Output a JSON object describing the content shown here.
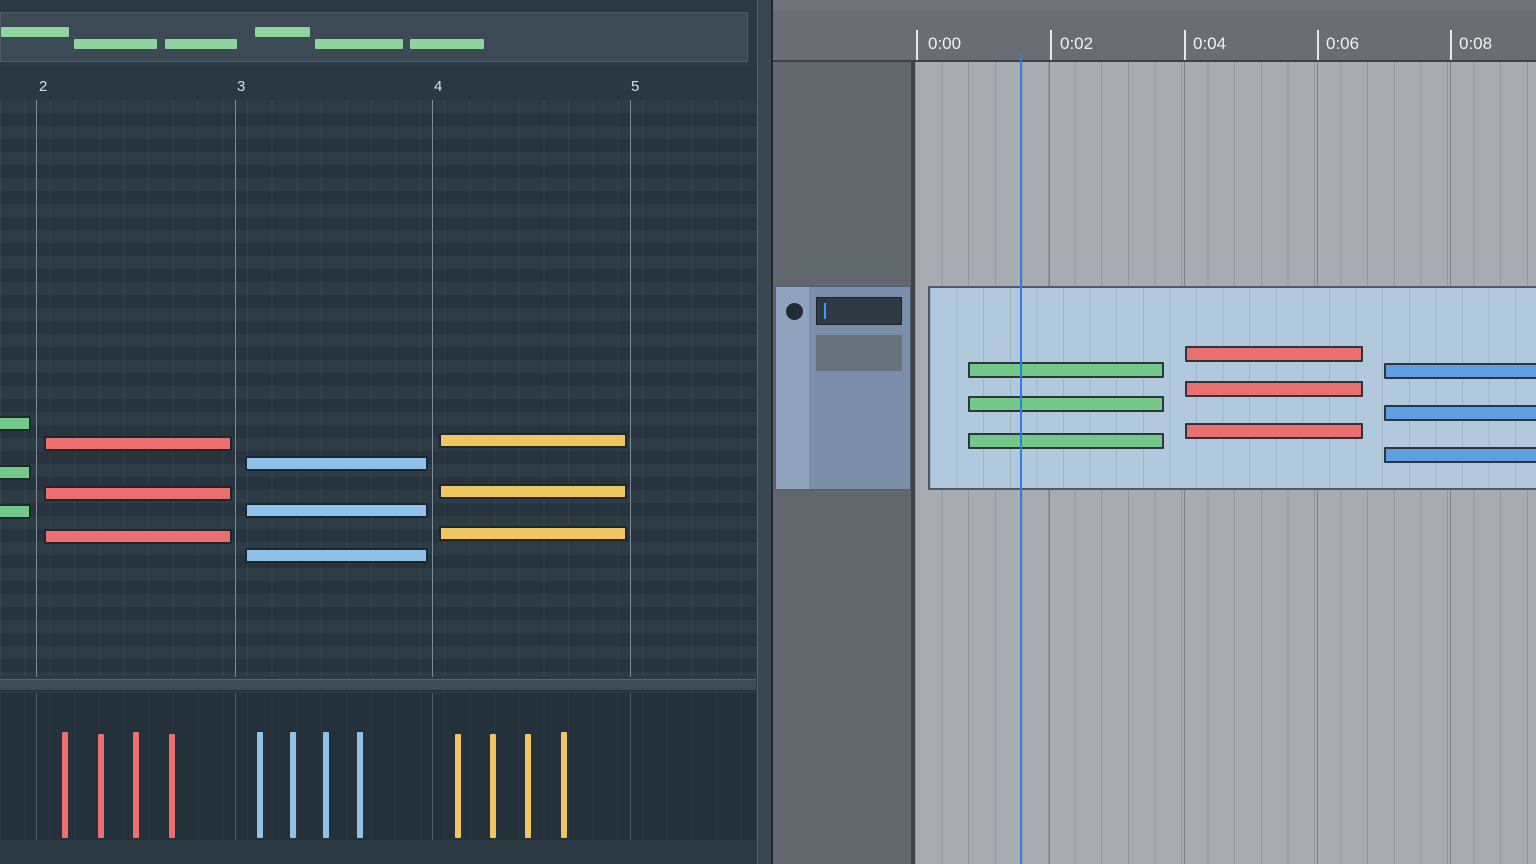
{
  "piano_roll": {
    "bar_numbers": [
      "2",
      "3",
      "4",
      "5"
    ],
    "note_colors": {
      "green": "#72c98a",
      "red": "#ec6f6f",
      "blue": "#8ec2ea",
      "yellow": "#f1c660"
    }
  },
  "arrangement": {
    "time_labels": [
      "0:00",
      "0:02",
      "0:04",
      "0:06",
      "0:08"
    ],
    "track": {
      "name": ""
    },
    "playhead_color": "#2d7fe0"
  }
}
